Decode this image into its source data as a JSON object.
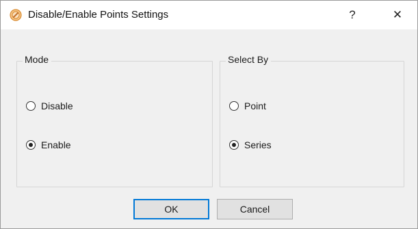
{
  "window": {
    "title": "Disable/Enable Points Settings",
    "help_label": "?",
    "close_label": "✕"
  },
  "mode_group": {
    "label": "Mode",
    "options": [
      {
        "label": "Disable",
        "checked": false
      },
      {
        "label": "Enable",
        "checked": true
      }
    ]
  },
  "select_group": {
    "label": "Select By",
    "options": [
      {
        "label": "Point",
        "checked": false
      },
      {
        "label": "Series",
        "checked": true
      }
    ]
  },
  "buttons": {
    "ok_label": "OK",
    "cancel_label": "Cancel"
  },
  "colors": {
    "accent": "#0078d7",
    "app_icon": "#e8a24a"
  }
}
